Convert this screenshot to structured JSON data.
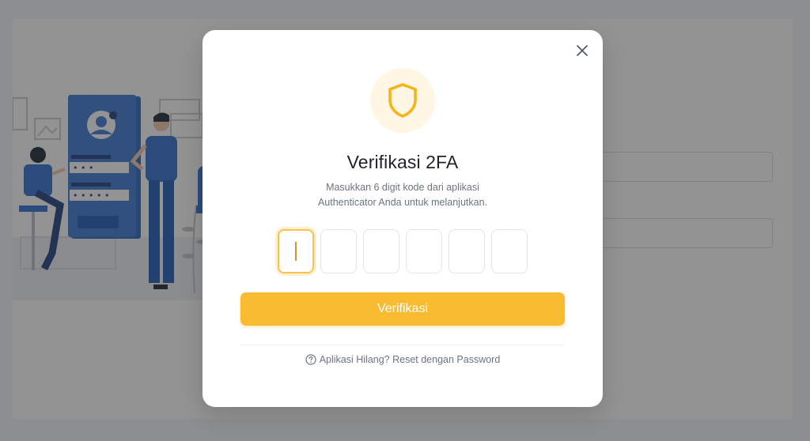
{
  "modal": {
    "title": "Verifikasi 2FA",
    "subtitle_line1": "Masukkan 6 digit kode dari aplikasi",
    "subtitle_line2": "Authenticator Anda untuk melanjutkan.",
    "otp_digits": [
      "",
      "",
      "",
      "",
      "",
      ""
    ],
    "active_digit_index": 0,
    "verify_label": "Verifikasi",
    "reset_link_label": "Aplikasi Hilang? Reset dengan Password",
    "icons": {
      "header": "shield-icon",
      "close": "close-icon",
      "help": "question-circle-icon"
    }
  },
  "background": {
    "password_dots_1": "• • •",
    "password_dots_2": "• • • • •"
  },
  "colors": {
    "accent": "#f9bb2f",
    "accent_soft": "#fff6e3",
    "illustration_blue": "#1e5bb8",
    "overlay": "rgba(40,40,40,0.5)"
  }
}
